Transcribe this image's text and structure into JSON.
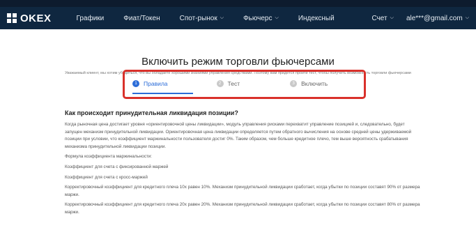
{
  "nav": {
    "logo_text": "OKEX",
    "items": [
      {
        "label": "Графики",
        "caret": false
      },
      {
        "label": "Фиат/Токен",
        "caret": false
      },
      {
        "label": "Спот-рынок",
        "caret": true
      },
      {
        "label": "Фьючерс",
        "caret": true
      },
      {
        "label": "Индексный",
        "caret": false
      }
    ],
    "account_label": "Счет",
    "email": "ale***@gmail.com"
  },
  "page": {
    "title": "Включить режим торговли фьючерсами",
    "intro": "Уважаемый клиент, мы хотим убедиться, что вы обладаете хорошими знаниями управления средствами. Поэтому вам придется пройти тест, чтобы получить возможность торговли фьючерсами"
  },
  "steps": [
    {
      "num": "1",
      "label": "Правила"
    },
    {
      "num": "2",
      "label": "Тест"
    },
    {
      "num": "3",
      "label": "Включить"
    }
  ],
  "content": {
    "heading": "Как происходит принудительная ликвидация позиции?",
    "paragraphs": [
      "Когда рыночная цена достигает уровня «ориентировочной цены ликвидации», модуль управления рисками перехватит управление позицией и, следовательно, будет запущен механизм принудительной ликвидации. Ориентировочная цена ликвидации определяется путем обратного вычисления на основе средней цены удерживаемой позиции при условии, что коэффициент маржинальности пользователя достиг 0%. Таким образом, чем больше кредитное плечо, тем выше вероятность срабатывания механизма принудительной ликвидации позиции.",
      "Формула коэффициента маржинальности:",
      "Коэффициент для счета с фиксированной маржей",
      "Коэффициент для счета с кросс-маржей",
      "Корректировочный коэффициент для кредитного плеча 10х равен 10%. Механизм принудительной ликвидации сработает, когда убытки по позиции составят 90% от размера маржи.",
      "Корректировочный коэффициент для кредитного плеча 20х равен 20%. Механизм принудительной ликвидации сработает, когда убытки по позиции составят 80% от размера маржи."
    ]
  },
  "colors": {
    "nav_bg": "#0f2740",
    "accent": "#2b6cd8",
    "highlight_border": "#d9312b"
  }
}
